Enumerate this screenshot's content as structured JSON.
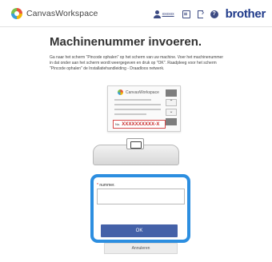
{
  "header": {
    "app_name": "CanvasWorkspace",
    "username": "xxxxxx",
    "brand": "brother",
    "icons": [
      "canvasworkspace-logo-icon",
      "user-icon",
      "document-icon",
      "sign-out-icon",
      "help-icon"
    ]
  },
  "main": {
    "title": "Machinenummer invoeren.",
    "description": "Ga naar het scherm \"Pincode ophalen\" op het scherm van uw machine. Voer het machinenummer in dat onder aan het scherm wordt weergegeven en druk op \"OK\". Raadpleeg voor het scherm \"Pincode ophalen\" de Installatiehandleiding - Draadloos netwerk."
  },
  "illustration": {
    "screen_app_name": "CanvasWorkspace",
    "code_label": "No.",
    "code_value": "XXXXXXXXXX-X"
  },
  "form": {
    "required_mark": "*",
    "label": "nummer.",
    "input_value": "",
    "ok_label": "OK",
    "cancel_label": "Annuleren"
  },
  "colors": {
    "highlight": "#2c8ee0",
    "primary_button": "#4461a8",
    "brand": "#1f3a8a",
    "code_highlight": "#c62828"
  }
}
